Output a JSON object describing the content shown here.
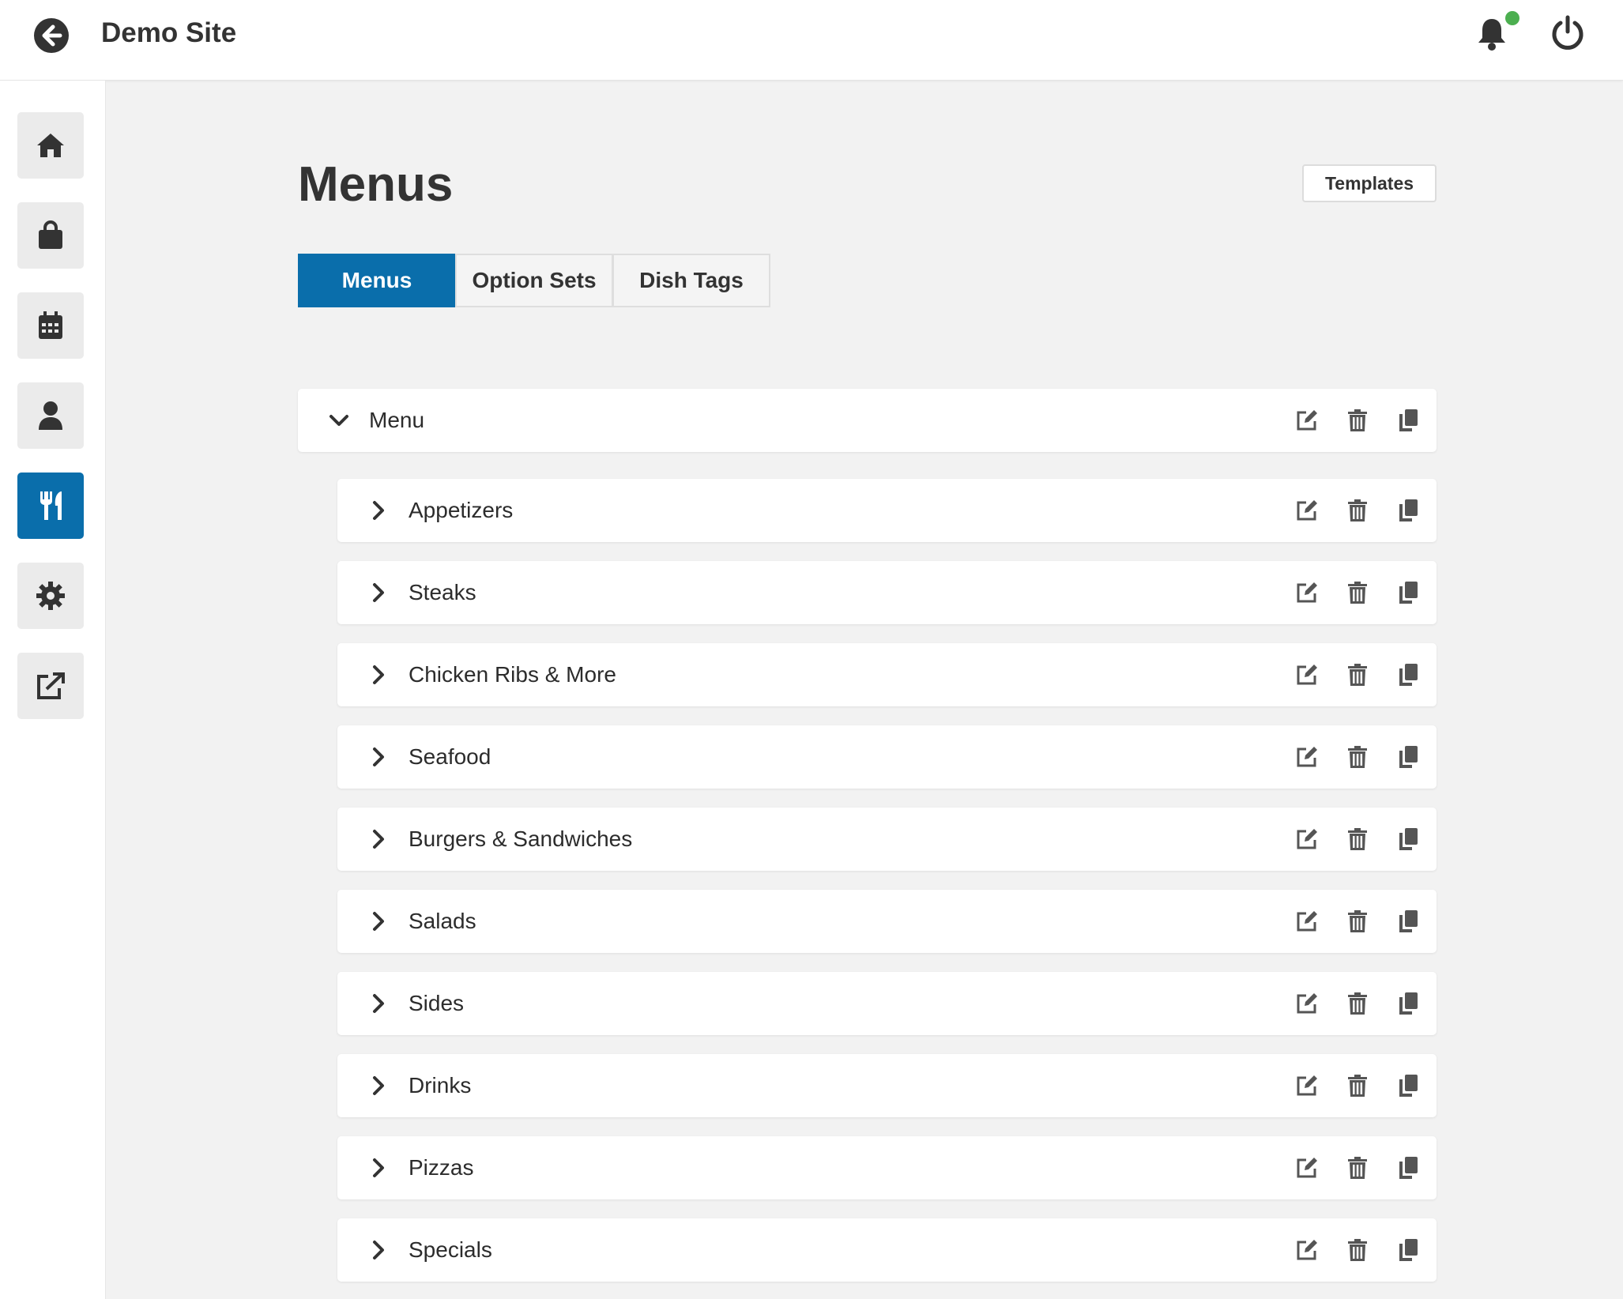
{
  "header": {
    "site_title": "Demo Site"
  },
  "sidebar": {
    "items": [
      {
        "name": "home",
        "icon": "home-icon"
      },
      {
        "name": "orders",
        "icon": "shopping-bag-icon"
      },
      {
        "name": "bookings",
        "icon": "calendar-icon"
      },
      {
        "name": "customers",
        "icon": "user-icon"
      },
      {
        "name": "menus",
        "icon": "utensils-icon",
        "active": true
      },
      {
        "name": "settings",
        "icon": "gear-icon"
      },
      {
        "name": "external",
        "icon": "external-link-icon"
      }
    ]
  },
  "main": {
    "title": "Menus",
    "templates_label": "Templates",
    "tabs": [
      {
        "label": "Menus",
        "active": true
      },
      {
        "label": "Option Sets"
      },
      {
        "label": "Dish Tags"
      }
    ],
    "menu": {
      "label": "Menu",
      "expanded": true,
      "categories": [
        {
          "label": "Appetizers"
        },
        {
          "label": "Steaks"
        },
        {
          "label": "Chicken Ribs & More"
        },
        {
          "label": "Seafood"
        },
        {
          "label": "Burgers & Sandwiches"
        },
        {
          "label": "Salads"
        },
        {
          "label": "Sides"
        },
        {
          "label": "Drinks"
        },
        {
          "label": "Pizzas"
        },
        {
          "label": "Specials"
        }
      ]
    }
  },
  "colors": {
    "accent": "#0a6eab",
    "online": "#4caf50",
    "icon": "#555555"
  }
}
